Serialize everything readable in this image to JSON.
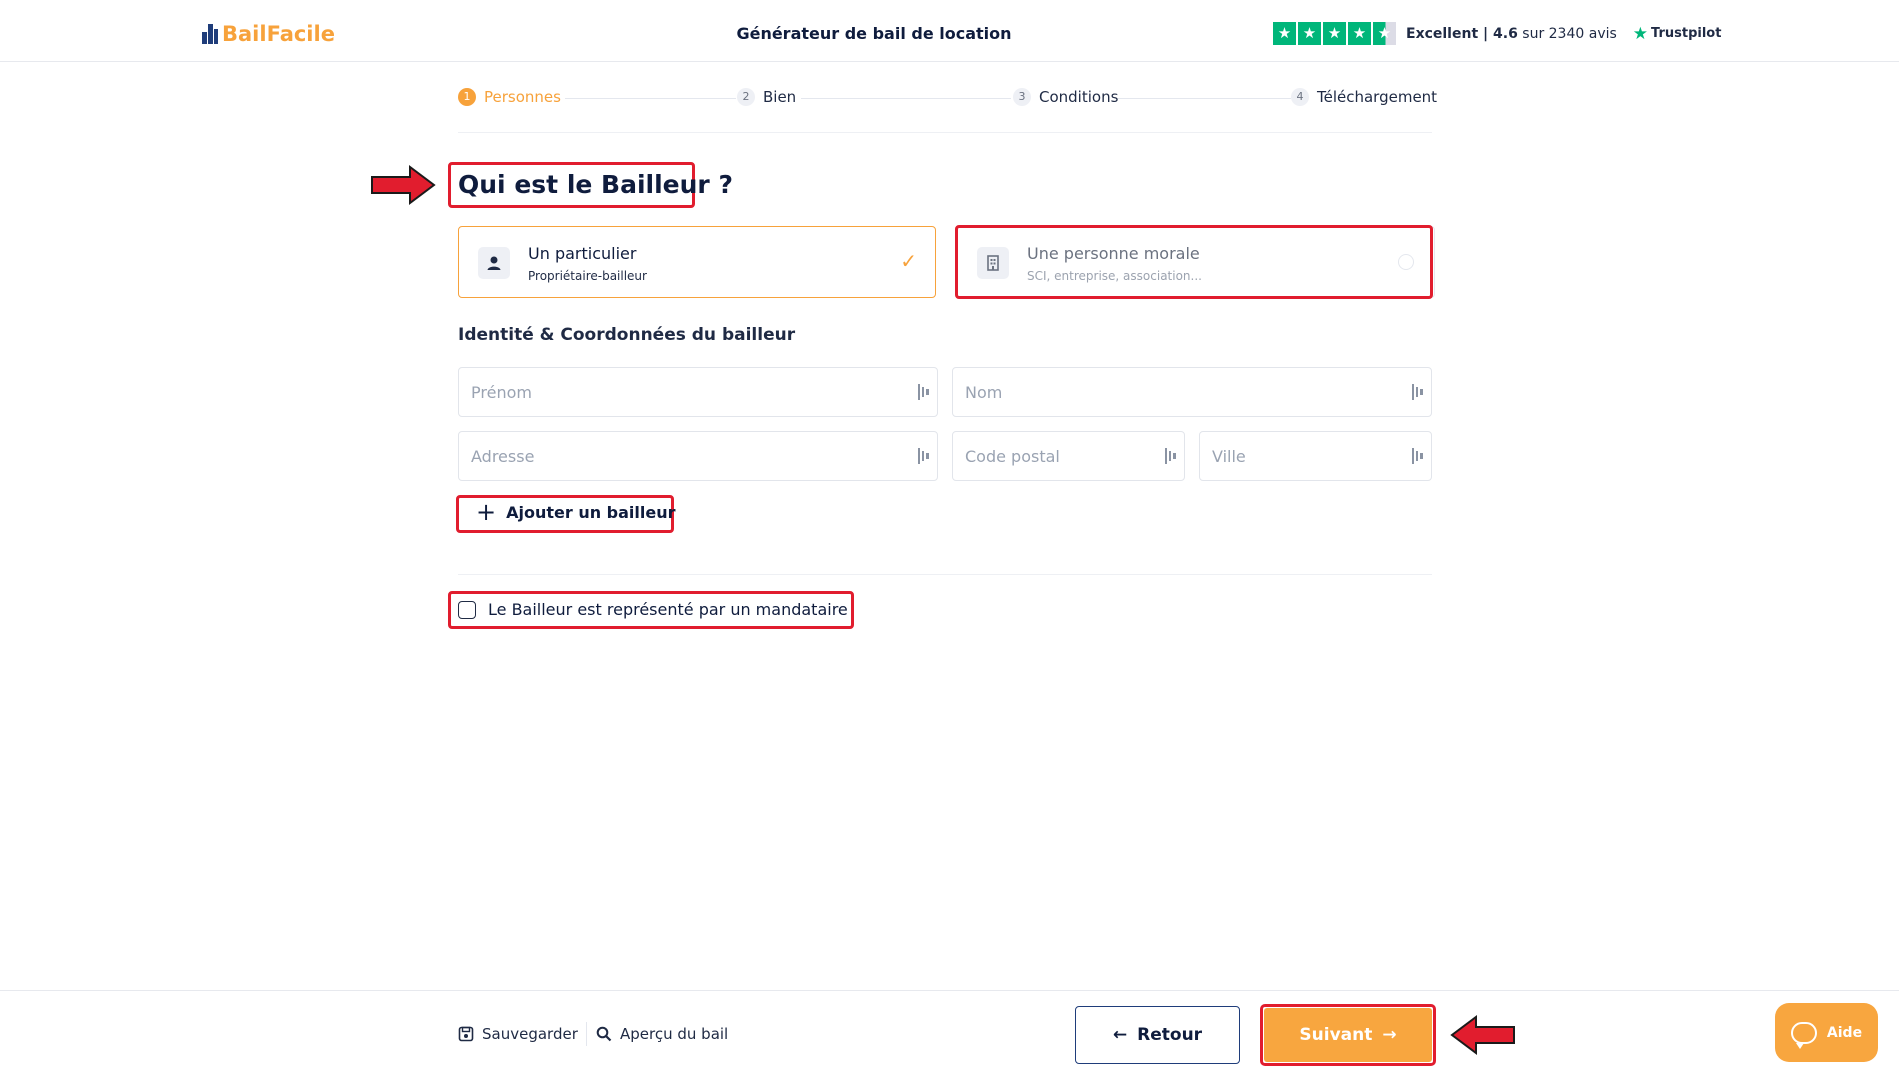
{
  "header": {
    "logo": "BailFacile",
    "title": "Générateur de bail de location",
    "rating_label": "Excellent",
    "rating_value": "4.6",
    "rating_suffix": "sur 2340 avis",
    "rating_stars": 4.5,
    "trustpilot": "Trustpilot"
  },
  "stepper": [
    {
      "num": "1",
      "label": "Personnes",
      "active": true
    },
    {
      "num": "2",
      "label": "Bien",
      "active": false
    },
    {
      "num": "3",
      "label": "Conditions",
      "active": false
    },
    {
      "num": "4",
      "label": "Téléchargement",
      "active": false
    }
  ],
  "main": {
    "title": "Qui est le Bailleur ?",
    "cards": [
      {
        "title": "Un particulier",
        "subtitle": "Propriétaire-bailleur",
        "selected": true,
        "icon": "person-icon"
      },
      {
        "title": "Une personne morale",
        "subtitle": "SCI, entreprise, association...",
        "selected": false,
        "icon": "building-icon"
      }
    ],
    "section_heading": "Identité & Coordonnées du bailleur",
    "fields": {
      "prenom": {
        "placeholder": "Prénom",
        "value": ""
      },
      "nom": {
        "placeholder": "Nom",
        "value": ""
      },
      "adresse": {
        "placeholder": "Adresse",
        "value": ""
      },
      "code_postal": {
        "placeholder": "Code postal",
        "value": ""
      },
      "ville": {
        "placeholder": "Ville",
        "value": ""
      }
    },
    "add_button": "Ajouter un bailleur",
    "mandataire_label": "Le Bailleur est représenté par un mandataire",
    "mandataire_checked": false
  },
  "footer": {
    "save": "Sauvegarder",
    "preview": "Aperçu du bail",
    "back": "Retour",
    "next": "Suivant",
    "help": "Aide"
  },
  "colors": {
    "accent": "#f7a23b",
    "navy": "#0f1c3d",
    "trustpilot_green": "#00b67a",
    "annotation_red": "#e11d2e"
  }
}
